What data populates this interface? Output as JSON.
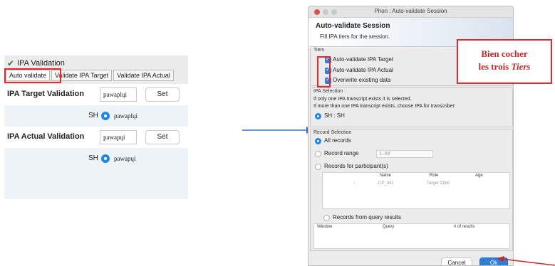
{
  "left_panel": {
    "header": "IPA Validation",
    "tabs": [
      "Auto validate",
      "Validate IPA Target",
      "Validate IPA Actual"
    ],
    "target": {
      "label": "IPA Target Validation",
      "value": "pawaplųi",
      "set_label": "Set",
      "speaker": "SH",
      "choice": "pawaplųi"
    },
    "actual": {
      "label": "IPA Actual Validation",
      "value": "pawapųi",
      "set_label": "Set",
      "speaker": "SH",
      "choice": "pawapųi"
    }
  },
  "dialog": {
    "window_title": "Phon : Auto-validate Session",
    "title": "Auto-validate Session",
    "subtitle": "Fill IPA tiers for the session.",
    "tiers": {
      "heading": "Tiers",
      "options": [
        "Auto-validate IPA Target",
        "Auto-validate IPA Actual",
        "Overwrite existing data"
      ]
    },
    "ipa_selection": {
      "heading": "IPA Selection",
      "line1": "If only one IPA transcript exists it is selected.",
      "line2": "If more than one IPA transcript exists, choose IPA for transcriber:",
      "transcriber": "SH : SH"
    },
    "record_selection": {
      "heading": "Record Selection",
      "all_records": "All records",
      "record_range": "Record range",
      "range_value": "1..68",
      "participants": "Records for participant(s)",
      "participant_columns": [
        "Name",
        "Role",
        "Age"
      ],
      "participant_rows": [
        {
          "name": "CP_041",
          "role": "Target Child",
          "age": ""
        }
      ],
      "query": "Records from query results",
      "query_columns": [
        "Window",
        "Query",
        "# of results"
      ]
    },
    "cancel_label": "Cancel",
    "ok_label": "Ok"
  },
  "annotation": {
    "line1": "Bien cocher",
    "line2": "les trois",
    "emphasis": "Tiers"
  },
  "colors": {
    "highlight": "#e8262b",
    "accent": "#1e88e5",
    "note_text": "#c62828"
  }
}
